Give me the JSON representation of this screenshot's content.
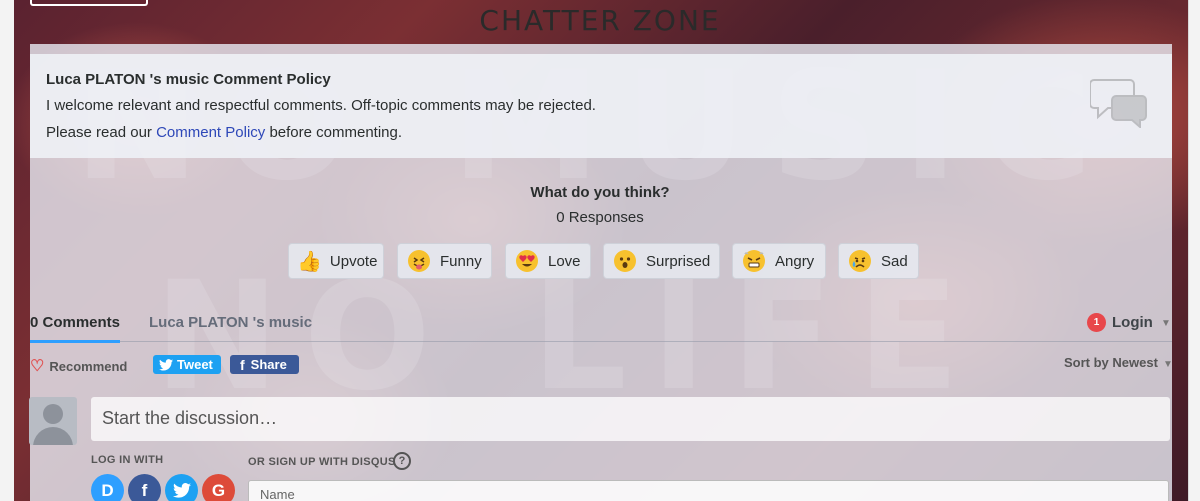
{
  "site": {
    "title": "CHATTER ZONE"
  },
  "policy": {
    "title": "Luca PLATON 's music Comment Policy",
    "line1": "I welcome relevant and respectful comments. Off-topic comments may be rejected.",
    "line2_prefix": "Please read our",
    "line2_link": "Comment Policy",
    "line2_suffix": "before commenting."
  },
  "reactions": {
    "prompt": "What do you think?",
    "responses": "0 Responses",
    "items": [
      {
        "label": "Upvote",
        "icon": "thumbs-up-icon"
      },
      {
        "label": "Funny",
        "icon": "tongue-face-icon"
      },
      {
        "label": "Love",
        "icon": "heart-eyes-icon"
      },
      {
        "label": "Surprised",
        "icon": "surprised-face-icon"
      },
      {
        "label": "Angry",
        "icon": "angry-face-icon"
      },
      {
        "label": "Sad",
        "icon": "sad-face-icon"
      }
    ]
  },
  "tabs": {
    "comments": "0 Comments",
    "community": "Luca PLATON 's music",
    "login_badge": "1",
    "login": "Login"
  },
  "actions": {
    "recommend": "Recommend",
    "tweet": "Tweet",
    "share": "Share",
    "sort": "Sort by Newest"
  },
  "compose": {
    "placeholder": "Start the discussion…",
    "login_with": "LOG IN WITH",
    "signup": "OR SIGN UP WITH DISQUS",
    "help": "?",
    "name_placeholder": "Name",
    "social": [
      {
        "letter": "D",
        "icon": "disqus-icon",
        "color": "#2e9fff"
      },
      {
        "letter": "f",
        "icon": "facebook-icon",
        "color": "#3b5998"
      },
      {
        "letter": "t",
        "icon": "twitter-icon",
        "color": "#1da1f2"
      },
      {
        "letter": "G",
        "icon": "google-icon",
        "color": "#dd4b39"
      }
    ]
  },
  "colors": {
    "accent": "#2e9fff",
    "link": "#2e48b8",
    "tweet": "#1da1f2",
    "share": "#3b5998",
    "badge": "#e8474b"
  }
}
